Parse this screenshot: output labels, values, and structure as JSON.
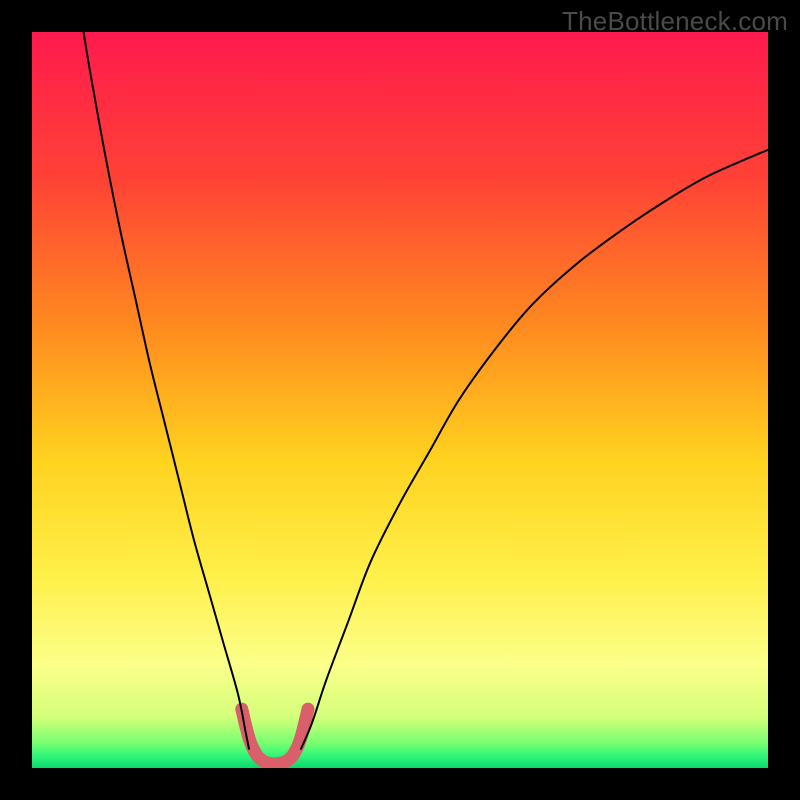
{
  "watermark": "TheBottleneck.com",
  "chart_data": {
    "type": "line",
    "title": "",
    "xlabel": "",
    "ylabel": "",
    "xlim": [
      0,
      100
    ],
    "ylim": [
      0,
      100
    ],
    "grid": false,
    "legend": false,
    "background_gradient": {
      "stops": [
        {
          "offset": 0.0,
          "color": "#ff1a4d"
        },
        {
          "offset": 0.2,
          "color": "#ff4236"
        },
        {
          "offset": 0.4,
          "color": "#ff8a1f"
        },
        {
          "offset": 0.58,
          "color": "#ffd21f"
        },
        {
          "offset": 0.74,
          "color": "#fff04a"
        },
        {
          "offset": 0.86,
          "color": "#fbff8a"
        },
        {
          "offset": 0.93,
          "color": "#d4ff7a"
        },
        {
          "offset": 0.965,
          "color": "#7bff70"
        },
        {
          "offset": 0.985,
          "color": "#2bf57a"
        },
        {
          "offset": 1.0,
          "color": "#0bd66b"
        }
      ]
    },
    "series": [
      {
        "name": "bottleneck-left",
        "color": "#000000",
        "width": 2,
        "x": [
          7,
          8,
          10,
          12,
          14,
          16,
          18,
          20,
          22,
          24,
          26,
          28,
          29,
          29.5
        ],
        "y": [
          100,
          94,
          83,
          73,
          64,
          55,
          47,
          39,
          31,
          24,
          17,
          10,
          5,
          2.5
        ]
      },
      {
        "name": "bottleneck-right",
        "color": "#000000",
        "width": 2,
        "x": [
          36.5,
          38,
          40,
          43,
          46,
          50,
          54,
          58,
          63,
          68,
          74,
          80,
          86,
          92,
          100
        ],
        "y": [
          2.5,
          6,
          12,
          20,
          28,
          36,
          43,
          50,
          57,
          63,
          68.5,
          73,
          77,
          80.5,
          84
        ]
      },
      {
        "name": "optimal-zone",
        "color": "#d9606b",
        "width": 13,
        "linecap": "round",
        "x": [
          28.5,
          29.5,
          30.5,
          31.5,
          32.5,
          33.5,
          34.5,
          35.5,
          36.5,
          37.5
        ],
        "y": [
          8,
          4,
          1.8,
          0.9,
          0.6,
          0.6,
          0.9,
          1.8,
          4,
          8
        ]
      }
    ]
  }
}
